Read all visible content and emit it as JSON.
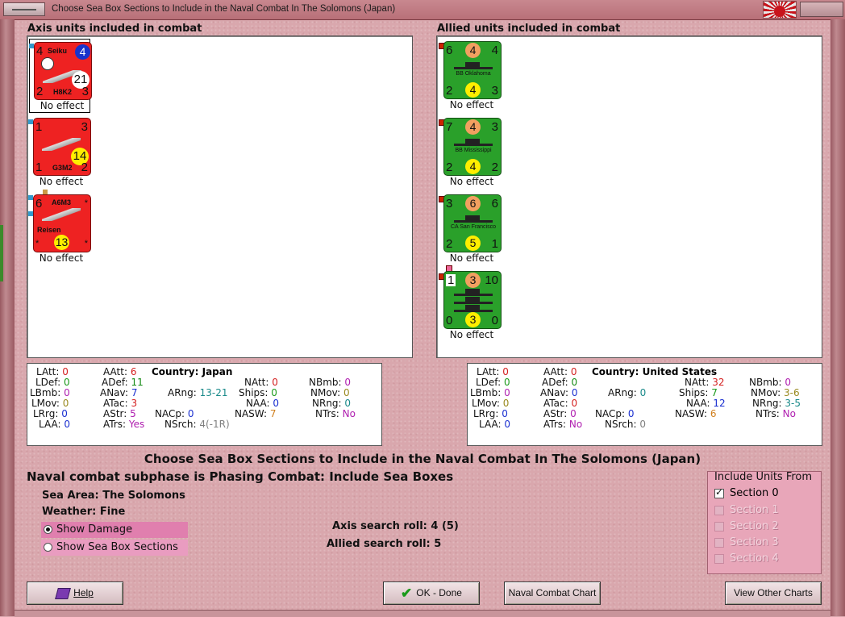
{
  "window": {
    "title": "Choose Sea Box Sections to Include in the Naval Combat In The Solomons (Japan)"
  },
  "axis": {
    "heading": "Axis units included in combat",
    "units": [
      {
        "tl": "4",
        "tr": "4",
        "bl": "2",
        "br": "3",
        "name_top": "Seiku",
        "name_bottom": "H8K2",
        "circle": "21",
        "effect": "No effect"
      },
      {
        "tl": "1",
        "tr": "3",
        "bl": "1",
        "br": "2",
        "name_bottom": "G3M2",
        "circle": "14",
        "effect": "No effect"
      },
      {
        "tl": "6",
        "tr": "*",
        "bl": "*",
        "br": "*",
        "name_top": "A6M3",
        "name_bottom": "Reisen",
        "circle": "13",
        "effect": "No effect"
      }
    ]
  },
  "allied": {
    "heading": "Allied units included in combat",
    "units": [
      {
        "tl": "6",
        "top": "4",
        "tr": "4",
        "bl": "2",
        "bot": "4",
        "br": "3",
        "name": "BB Oklahoma",
        "effect": "No effect"
      },
      {
        "tl": "7",
        "top": "4",
        "tr": "3",
        "bl": "2",
        "bot": "4",
        "br": "2",
        "name": "BB Mississippi",
        "effect": "No effect"
      },
      {
        "tl": "3",
        "top": "6",
        "tr": "6",
        "bl": "2",
        "bot": "5",
        "br": "1",
        "name": "CA San Francisco",
        "effect": "No effect"
      },
      {
        "tl": "1",
        "top": "3",
        "tr": "10",
        "bl": "0",
        "bot": "3",
        "br": "0",
        "name": "",
        "effect": "No effect"
      }
    ]
  },
  "axis_stats": {
    "LAtt": "0",
    "LDef": "0",
    "LBmb": "0",
    "LMov": "0",
    "LRrg": "0",
    "LAA": "0",
    "AAtt": "6",
    "ADef": "11",
    "ANav": "7",
    "ATac": "3",
    "AStr": "5",
    "ATrs": "Yes",
    "country_label": "Country:",
    "country": "Japan",
    "ARng": "13-21",
    "NACp": "0",
    "NSrch": "4(-1R)",
    "NAtt": "0",
    "Ships": "0",
    "NAA": "0",
    "NASW": "7",
    "NBmb": "0",
    "NMov": "0",
    "NRng": "0",
    "NTrs": "No"
  },
  "allied_stats": {
    "LAtt": "0",
    "LDef": "0",
    "LBmb": "0",
    "LMov": "0",
    "LRrg": "0",
    "LAA": "0",
    "AAtt": "0",
    "ADef": "0",
    "ANav": "0",
    "ATac": "0",
    "AStr": "0",
    "ATrs": "No",
    "country_label": "Country:",
    "country": "United States",
    "ARng": "0",
    "NACp": "0",
    "NSrch": "0",
    "NAtt": "32",
    "Ships": "7",
    "NAA": "12",
    "NASW": "6",
    "NBmb": "0",
    "NMov": "3-6",
    "NRng": "3-5",
    "NTrs": "No"
  },
  "main_title": "Choose Sea Box Sections to Include in the Naval Combat In The Solomons (Japan)",
  "subphase": "Naval combat subphase is Phasing Combat: Include Sea Boxes",
  "sea_area": "Sea Area:  The Solomons",
  "weather": "Weather:  Fine",
  "show_damage": "Show Damage",
  "show_sections": "Show Sea Box Sections",
  "axis_roll": "Axis search roll: 4 (5)",
  "allied_roll": "Allied search roll: 5",
  "include_from": {
    "title": "Include Units From",
    "sections": [
      "Section 0",
      "Section 1",
      "Section 2",
      "Section 3",
      "Section 4"
    ]
  },
  "buttons": {
    "help": "Help",
    "ok": "OK - Done",
    "chart": "Naval Combat Chart",
    "other": "View Other Charts"
  }
}
